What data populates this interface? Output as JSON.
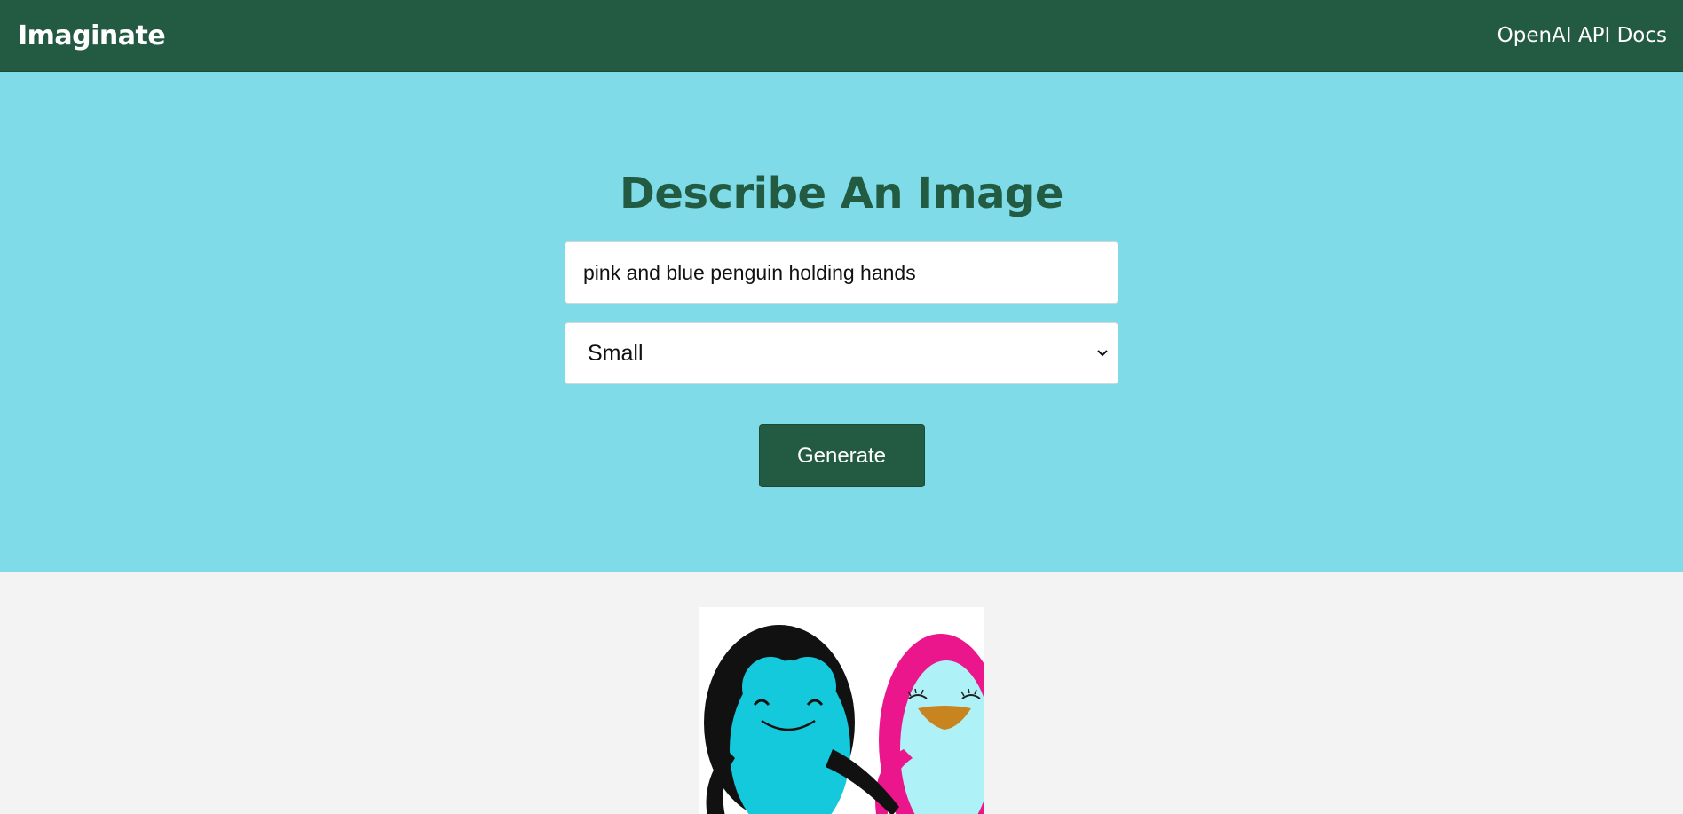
{
  "navbar": {
    "logo": "Imaginate",
    "docs_link": "OpenAI API Docs"
  },
  "hero": {
    "title": "Describe An Image",
    "prompt_value": "pink and blue penguin holding hands",
    "size_select": {
      "selected": "Small"
    },
    "generate_label": "Generate"
  },
  "colors": {
    "brand": "#235b42",
    "hero_bg": "#7fdbe7",
    "results_bg": "#f3f3f3"
  },
  "result_image": {
    "icon": "penguins-image"
  }
}
